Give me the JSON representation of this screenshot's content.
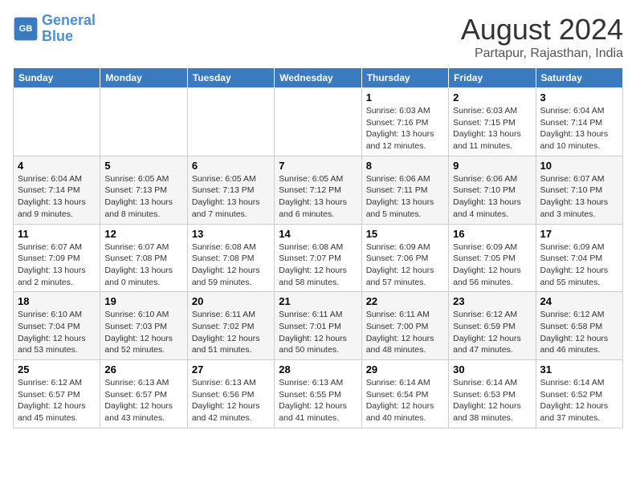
{
  "header": {
    "logo_line1": "General",
    "logo_line2": "Blue",
    "month_year": "August 2024",
    "location": "Partapur, Rajasthan, India"
  },
  "days_of_week": [
    "Sunday",
    "Monday",
    "Tuesday",
    "Wednesday",
    "Thursday",
    "Friday",
    "Saturday"
  ],
  "weeks": [
    [
      {
        "day": "",
        "info": ""
      },
      {
        "day": "",
        "info": ""
      },
      {
        "day": "",
        "info": ""
      },
      {
        "day": "",
        "info": ""
      },
      {
        "day": "1",
        "info": "Sunrise: 6:03 AM\nSunset: 7:16 PM\nDaylight: 13 hours\nand 12 minutes."
      },
      {
        "day": "2",
        "info": "Sunrise: 6:03 AM\nSunset: 7:15 PM\nDaylight: 13 hours\nand 11 minutes."
      },
      {
        "day": "3",
        "info": "Sunrise: 6:04 AM\nSunset: 7:14 PM\nDaylight: 13 hours\nand 10 minutes."
      }
    ],
    [
      {
        "day": "4",
        "info": "Sunrise: 6:04 AM\nSunset: 7:14 PM\nDaylight: 13 hours\nand 9 minutes."
      },
      {
        "day": "5",
        "info": "Sunrise: 6:05 AM\nSunset: 7:13 PM\nDaylight: 13 hours\nand 8 minutes."
      },
      {
        "day": "6",
        "info": "Sunrise: 6:05 AM\nSunset: 7:13 PM\nDaylight: 13 hours\nand 7 minutes."
      },
      {
        "day": "7",
        "info": "Sunrise: 6:05 AM\nSunset: 7:12 PM\nDaylight: 13 hours\nand 6 minutes."
      },
      {
        "day": "8",
        "info": "Sunrise: 6:06 AM\nSunset: 7:11 PM\nDaylight: 13 hours\nand 5 minutes."
      },
      {
        "day": "9",
        "info": "Sunrise: 6:06 AM\nSunset: 7:10 PM\nDaylight: 13 hours\nand 4 minutes."
      },
      {
        "day": "10",
        "info": "Sunrise: 6:07 AM\nSunset: 7:10 PM\nDaylight: 13 hours\nand 3 minutes."
      }
    ],
    [
      {
        "day": "11",
        "info": "Sunrise: 6:07 AM\nSunset: 7:09 PM\nDaylight: 13 hours\nand 2 minutes."
      },
      {
        "day": "12",
        "info": "Sunrise: 6:07 AM\nSunset: 7:08 PM\nDaylight: 13 hours\nand 0 minutes."
      },
      {
        "day": "13",
        "info": "Sunrise: 6:08 AM\nSunset: 7:08 PM\nDaylight: 12 hours\nand 59 minutes."
      },
      {
        "day": "14",
        "info": "Sunrise: 6:08 AM\nSunset: 7:07 PM\nDaylight: 12 hours\nand 58 minutes."
      },
      {
        "day": "15",
        "info": "Sunrise: 6:09 AM\nSunset: 7:06 PM\nDaylight: 12 hours\nand 57 minutes."
      },
      {
        "day": "16",
        "info": "Sunrise: 6:09 AM\nSunset: 7:05 PM\nDaylight: 12 hours\nand 56 minutes."
      },
      {
        "day": "17",
        "info": "Sunrise: 6:09 AM\nSunset: 7:04 PM\nDaylight: 12 hours\nand 55 minutes."
      }
    ],
    [
      {
        "day": "18",
        "info": "Sunrise: 6:10 AM\nSunset: 7:04 PM\nDaylight: 12 hours\nand 53 minutes."
      },
      {
        "day": "19",
        "info": "Sunrise: 6:10 AM\nSunset: 7:03 PM\nDaylight: 12 hours\nand 52 minutes."
      },
      {
        "day": "20",
        "info": "Sunrise: 6:11 AM\nSunset: 7:02 PM\nDaylight: 12 hours\nand 51 minutes."
      },
      {
        "day": "21",
        "info": "Sunrise: 6:11 AM\nSunset: 7:01 PM\nDaylight: 12 hours\nand 50 minutes."
      },
      {
        "day": "22",
        "info": "Sunrise: 6:11 AM\nSunset: 7:00 PM\nDaylight: 12 hours\nand 48 minutes."
      },
      {
        "day": "23",
        "info": "Sunrise: 6:12 AM\nSunset: 6:59 PM\nDaylight: 12 hours\nand 47 minutes."
      },
      {
        "day": "24",
        "info": "Sunrise: 6:12 AM\nSunset: 6:58 PM\nDaylight: 12 hours\nand 46 minutes."
      }
    ],
    [
      {
        "day": "25",
        "info": "Sunrise: 6:12 AM\nSunset: 6:57 PM\nDaylight: 12 hours\nand 45 minutes."
      },
      {
        "day": "26",
        "info": "Sunrise: 6:13 AM\nSunset: 6:57 PM\nDaylight: 12 hours\nand 43 minutes."
      },
      {
        "day": "27",
        "info": "Sunrise: 6:13 AM\nSunset: 6:56 PM\nDaylight: 12 hours\nand 42 minutes."
      },
      {
        "day": "28",
        "info": "Sunrise: 6:13 AM\nSunset: 6:55 PM\nDaylight: 12 hours\nand 41 minutes."
      },
      {
        "day": "29",
        "info": "Sunrise: 6:14 AM\nSunset: 6:54 PM\nDaylight: 12 hours\nand 40 minutes."
      },
      {
        "day": "30",
        "info": "Sunrise: 6:14 AM\nSunset: 6:53 PM\nDaylight: 12 hours\nand 38 minutes."
      },
      {
        "day": "31",
        "info": "Sunrise: 6:14 AM\nSunset: 6:52 PM\nDaylight: 12 hours\nand 37 minutes."
      }
    ]
  ]
}
